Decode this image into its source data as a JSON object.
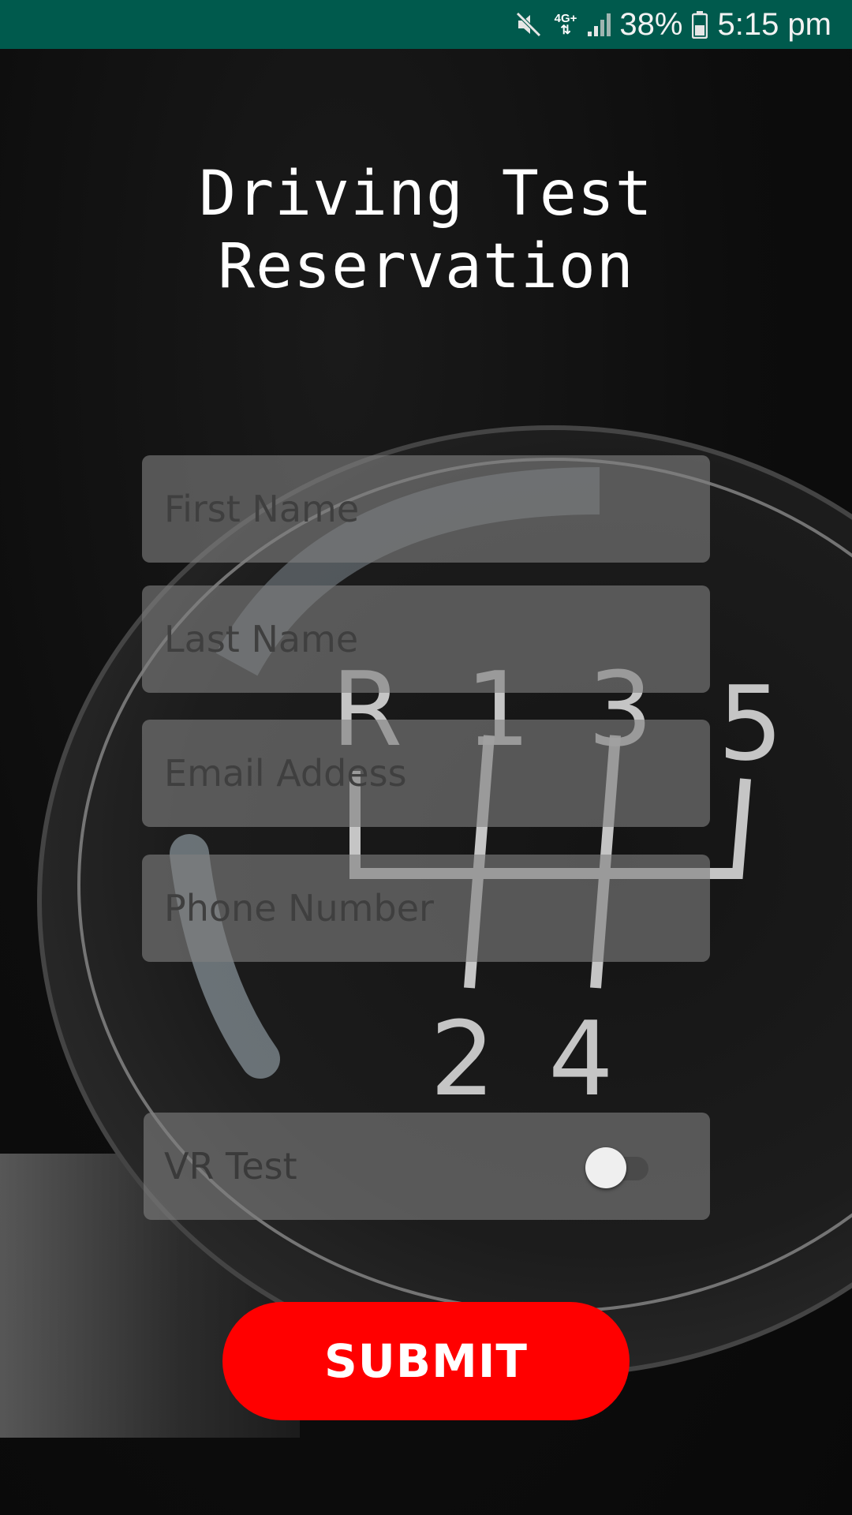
{
  "status_bar": {
    "network": "4G+",
    "battery": "38%",
    "time": "5:15 pm",
    "icons": [
      "mute-icon",
      "data-arrows-icon",
      "signal-icon",
      "battery-icon"
    ]
  },
  "background": {
    "gear_labels": [
      "R",
      "1",
      "3",
      "5",
      "2",
      "4"
    ]
  },
  "title": "Driving Test\nReservation",
  "form": {
    "first_name_placeholder": "First Name",
    "last_name_placeholder": "Last Name",
    "email_placeholder": "Email Addess",
    "phone_placeholder": "Phone Number",
    "vr_test_label": "VR Test",
    "vr_test_enabled": false,
    "submit_label": "SUBMIT"
  },
  "colors": {
    "status_bar": "#005a4d",
    "submit": "#ff0000",
    "field": "#808080"
  }
}
